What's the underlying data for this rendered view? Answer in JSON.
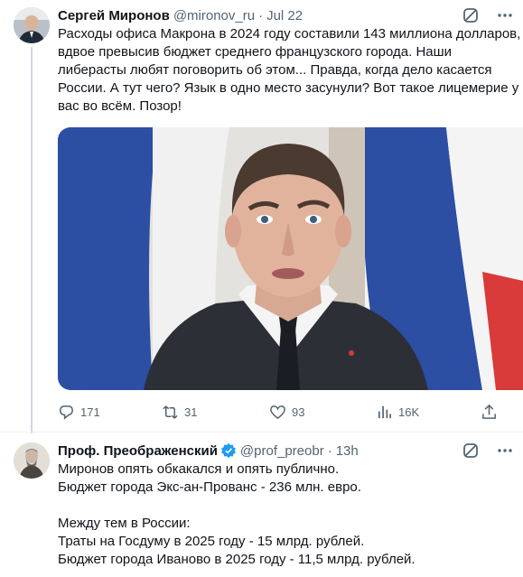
{
  "tweets": [
    {
      "author": "Сергей Миронов",
      "handle": "@mironov_ru",
      "separator": "·",
      "time": "Jul 22",
      "text_lines": [
        "Расходы офиса Макрона в 2024 году составили 143 миллиона долларов,",
        "вдвое превысив бюджет среднего французского города. Наши",
        "либерасты любят поговорить об этом... Правда, когда дело касается",
        "России. А тут чего? Язык в одно место засунули? Вот такое лицемерие у",
        "вас во всём. Позор!"
      ],
      "stats": {
        "replies": "171",
        "reposts": "31",
        "likes": "93",
        "views": "16K"
      }
    },
    {
      "author": "Проф. Преображенский",
      "handle": "@prof_preobr",
      "separator": "·",
      "time": "13h",
      "text_lines": [
        "Миронов опять обкакался и опять публично.",
        "Бюджет города Экс-ан-Прованс - 236 млн. евро.",
        "",
        "Между тем в России:",
        "Траты на Госдуму в 2025 году - 15 млрд. рублей.",
        "Бюджет города Иваново в 2025 году - 11,5 млрд. рублей."
      ]
    }
  ],
  "colors": {
    "text": "#0f1419",
    "secondary": "#536471",
    "verified_blue": "#1d9bf0",
    "flag_blue": "#2c4ea3",
    "flag_red": "#d93a3a"
  },
  "icons": {
    "header": "grok-slash-icon",
    "reply": "reply-icon",
    "repost": "repost-icon",
    "like": "heart-icon",
    "views": "views-bar-chart-icon",
    "share": "share-icon"
  }
}
